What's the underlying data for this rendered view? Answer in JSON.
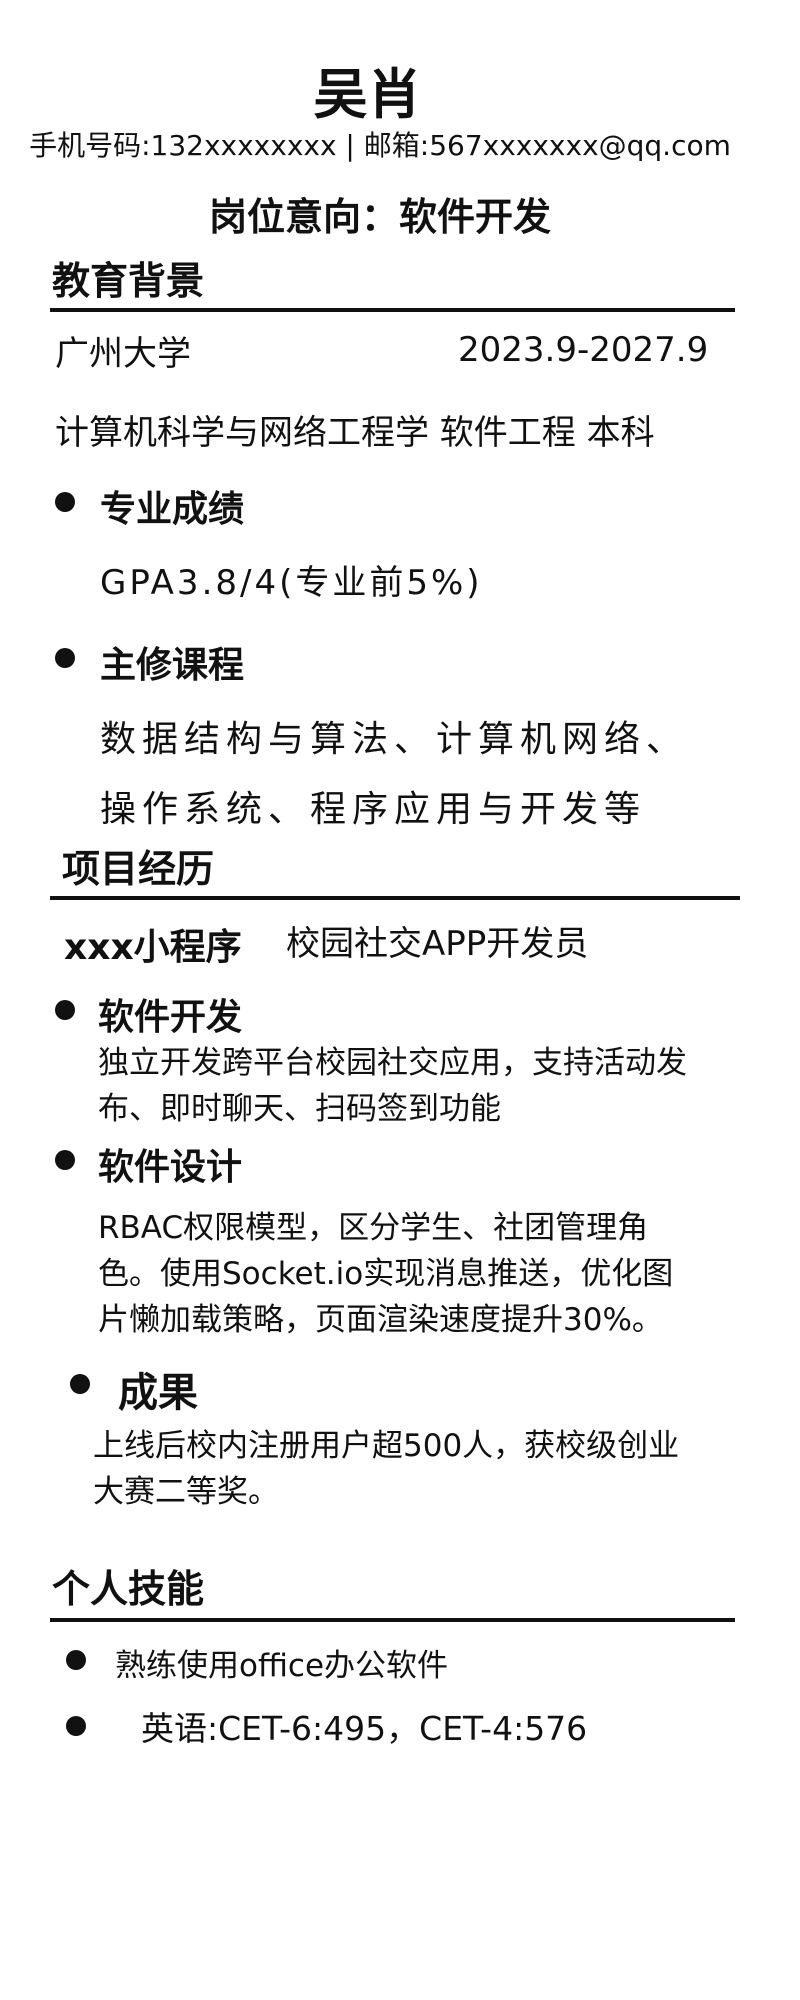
{
  "header": {
    "name": "吴肖",
    "contact": "手机号码:132xxxxxxxx | 邮箱:567xxxxxxx@qq.com",
    "intent": "岗位意向：软件开发"
  },
  "education": {
    "title": "教育背景",
    "school": "广州大学",
    "period": "2023.9-2027.9",
    "major": "计算机科学与网络工程学 软件工程 本科",
    "grades_title": "专业成绩",
    "grades": "GPA3.8/4(专业前5%)",
    "courses_title": "主修课程",
    "courses_line1": "数据结构与算法、计算机网络、",
    "courses_line2": "操作系统、程序应用与开发等"
  },
  "projects": {
    "title": "项目经历",
    "project_name": "xxx小程序",
    "role": "校园社交APP开发员",
    "items": [
      {
        "title": "软件开发",
        "lines": [
          "独立开发跨平台校园社交应用，支持活动发",
          "布、即时聊天、扫码签到功能"
        ]
      },
      {
        "title": "软件设计",
        "lines": [
          "RBAC权限模型，区分学生、社团管理角",
          "色。使用Socket.io实现消息推送，优化图",
          "片懒加载策略，页面渲染速度提升30%。"
        ]
      },
      {
        "title": "成果",
        "lines": [
          "上线后校内注册用户超500人，获校级创业",
          "大赛二等奖。"
        ]
      }
    ]
  },
  "skills": {
    "title": "个人技能",
    "items": [
      "熟练使用office办公软件",
      "英语:CET-6:495，CET-4:576"
    ]
  }
}
